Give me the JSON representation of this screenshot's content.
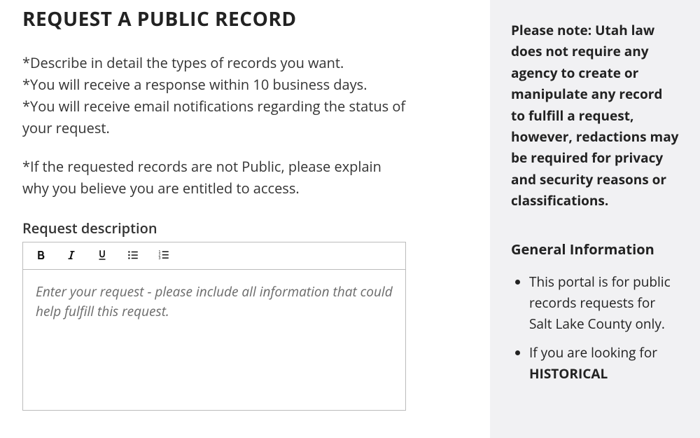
{
  "main": {
    "title": "REQUEST A PUBLIC RECORD",
    "instructions_line1": "*Describe in detail the types of records you want.",
    "instructions_line2": "*You will receive a response within 10 business days.",
    "instructions_line3": "*You will receive email notifications regarding the status of your request.",
    "instructions_line4": "*If the requested records are not Public, please explain why you believe you are entitled to access.",
    "field_label": "Request description",
    "editor_placeholder": "Enter your request - please include all information that could help fulfill this request."
  },
  "toolbar": {
    "bold_label": "Bold",
    "italic_label": "Italic",
    "underline_label": "Underline",
    "bullet_list_label": "Bulleted list",
    "numbered_list_label": "Numbered list"
  },
  "sidebar": {
    "note": "Please note: Utah law does not require any agency to create or manipulate any record to fulfill a request, however, redactions may be required for privacy and security reasons or classifications.",
    "heading": "General Information",
    "item1": "This portal is for public records requests for Salt Lake County only.",
    "item2_prefix": "If you are looking for ",
    "item2_bold": "HISTORICAL"
  }
}
